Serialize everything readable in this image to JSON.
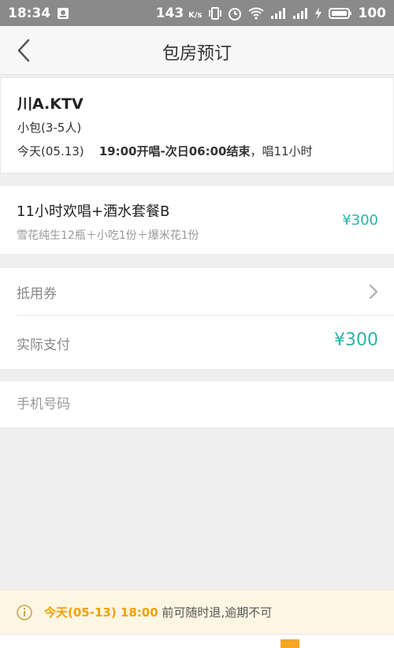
{
  "status_bar": {
    "time": "18:34",
    "speed": "143",
    "speed_unit": "K/s",
    "battery": "100"
  },
  "nav": {
    "title": "包房预订"
  },
  "booking": {
    "venue": "川A.KTV",
    "room_type": "小包(3-5人)",
    "day": "今天(05.13)",
    "start": "19:00开唱",
    "separator": "-",
    "end": "次日06:00结束",
    "duration": "，唱11小时"
  },
  "package": {
    "name": "11小时欢唱+酒水套餐B",
    "description": "雪花纯生12瓶＋小吃1份＋爆米花1份",
    "price": "¥300"
  },
  "payment": {
    "coupon_label": "抵用券",
    "actual_label": "实际支付",
    "actual_amount": "¥300"
  },
  "phone": {
    "placeholder": "手机号码"
  },
  "notice": {
    "highlight": "今天(05-13) 18:00",
    "text": " 前可随时退,逾期不可"
  },
  "colors": {
    "accent_teal": "#2bb3a6",
    "notice_orange": "#f0a000",
    "status_bar_bg": "#8a8a8a"
  },
  "icons": [
    "back-icon",
    "chevron-right-icon",
    "info-icon",
    "wifi-icon",
    "signal-icon",
    "battery-icon",
    "alarm-icon",
    "vibrate-icon",
    "notification-icon"
  ]
}
